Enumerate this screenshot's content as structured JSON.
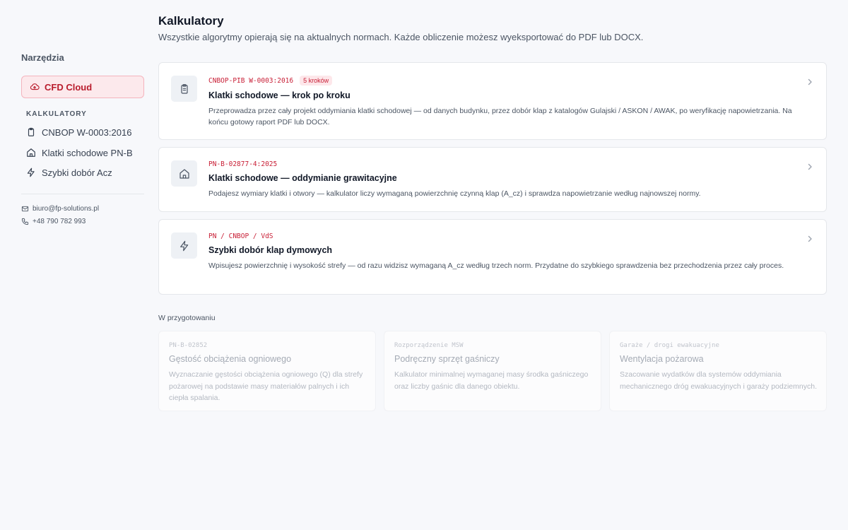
{
  "sidebar": {
    "heading": "Narzędzia",
    "cfd_label": "CFD Cloud",
    "section_label": "KALKULATORY",
    "items": [
      {
        "label": "CNBOP W-0003:2016",
        "icon": "clipboard-icon"
      },
      {
        "label": "Klatki schodowe PN-B",
        "icon": "home-icon"
      },
      {
        "label": "Szybki dobór Acz",
        "icon": "lightning-icon"
      }
    ],
    "email": "biuro@fp-solutions.pl",
    "phone": "+48 790 782 993"
  },
  "main": {
    "title": "Kalkulatory",
    "subtitle": "Wszystkie algorytmy opierają się na aktualnych normach. Każde obliczenie możesz wyeksportować do PDF lub DOCX.",
    "cards": [
      {
        "code": "CNBOP-PIB W-0003:2016",
        "badge": "5 kroków",
        "title": "Klatki schodowe — krok po kroku",
        "description": "Przeprowadza przez cały projekt oddymiania klatki schodowej — od danych budynku, przez dobór klap z katalogów Gulajski / ASKON / AWAK, po weryfikację napowietrzania. Na końcu gotowy raport PDF lub DOCX.",
        "icon": "clipboard-icon"
      },
      {
        "code": "PN-B-02877-4:2025",
        "title": "Klatki schodowe — oddymianie grawitacyjne",
        "description": "Podajesz wymiary klatki i otwory — kalkulator liczy wymaganą powierzchnię czynną klap (A_cz) i sprawdza napowietrzanie według najnowszej normy.",
        "icon": "home-icon"
      },
      {
        "code": "PN / CNBOP / VdS",
        "title": "Szybki dobór klap dymowych",
        "description": "Wpisujesz powierzchnię i wysokość strefy — od razu widzisz wymaganą A_cz według trzech norm. Przydatne do szybkiego sprawdzenia bez przechodzenia przez cały proces.",
        "icon": "lightning-icon"
      }
    ],
    "prep_heading": "W przygotowaniu",
    "prep_cards": [
      {
        "code": "PN-B-02852",
        "title": "Gęstość obciążenia ogniowego",
        "description": "Wyznaczanie gęstości obciążenia ogniowego (Q) dla strefy pożarowej na podstawie masy materiałów palnych i ich ciepła spalania."
      },
      {
        "code": "Rozporządzenie MSW",
        "title": "Podręczny sprzęt gaśniczy",
        "description": "Kalkulator minimalnej wymaganej masy środka gaśniczego oraz liczby gaśnic dla danego obiektu."
      },
      {
        "code": "Garaże / drogi ewakuacyjne",
        "title": "Wentylacja pożarowa",
        "description": "Szacowanie wydatków dla systemów oddymiania mechanicznego dróg ewakuacyjnych i garaży podziemnych."
      }
    ]
  },
  "colors": {
    "accent": "#c81e35",
    "accent_bg": "#fce9ec",
    "page_bg": "#f7f8fb"
  }
}
